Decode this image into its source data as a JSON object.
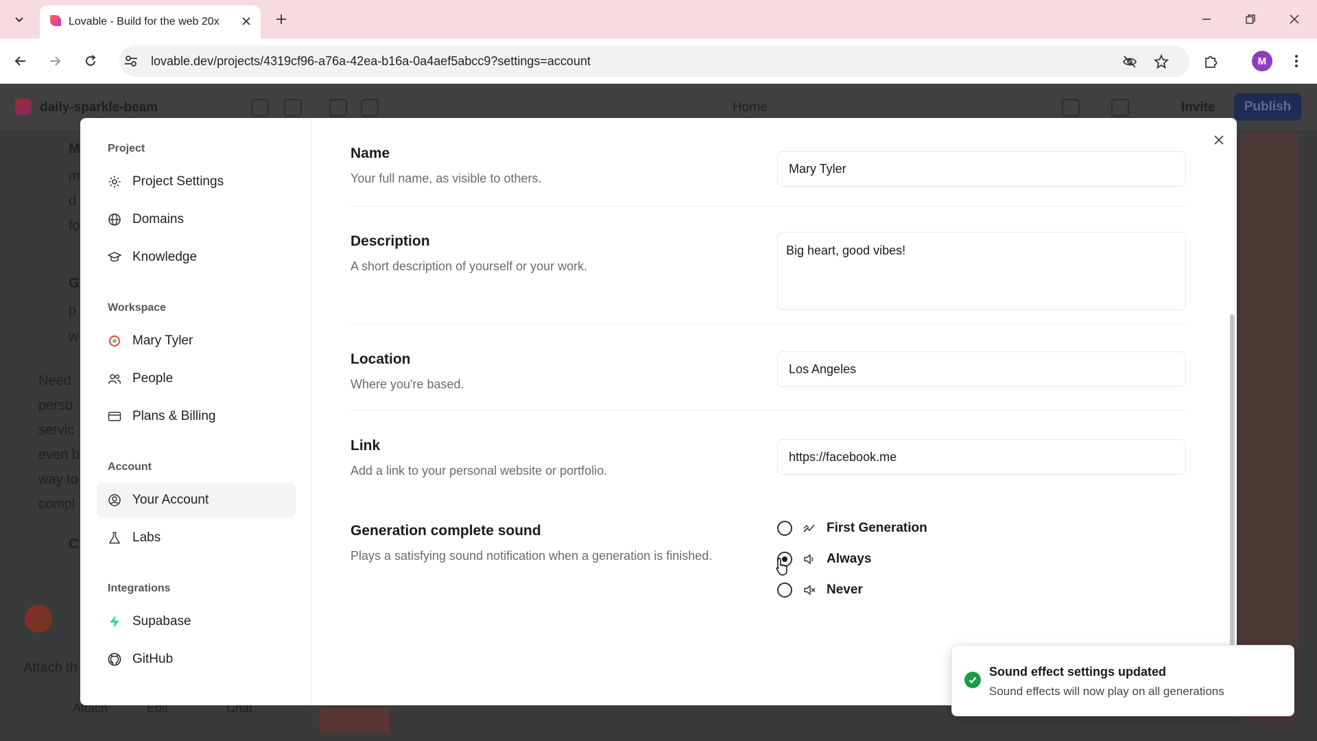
{
  "browser": {
    "tab_title": "Lovable - Build for the web 20x",
    "url": "lovable.dev/projects/4319cf96-a76a-42ea-b16a-0a4aef5abcc9?settings=account",
    "profile_initial": "M",
    "icons": {
      "tab_list": "chevron-down-icon",
      "favicon": "lovable-heart-icon",
      "tab_close": "close-icon",
      "new_tab": "plus-icon",
      "minimize": "minimize-icon",
      "restore": "restore-icon",
      "window_close": "close-icon",
      "back": "arrow-left-icon",
      "forward": "arrow-right-icon",
      "reload": "reload-icon",
      "site_settings": "tune-icon",
      "eye_off": "eye-off-icon",
      "bookmark": "star-icon",
      "extensions": "puzzle-icon",
      "menu": "kebab-icon"
    }
  },
  "background_app": {
    "project_name": "daily-sparkle-beam",
    "home_label": "Home",
    "invite_label": "Invite",
    "publish_label": "Publish",
    "chat_fragments": [
      "M",
      "m",
      "d",
      "fo",
      "G",
      "p",
      "w",
      "Need",
      "perso",
      "servic",
      "even b",
      "way to",
      "compl",
      "C"
    ],
    "composer_fragments": [
      "Attach th",
      "Attach",
      "Edit",
      "Chat"
    ]
  },
  "sidebar": {
    "sections": [
      {
        "title": "Project",
        "items": [
          {
            "label": "Project Settings",
            "icon": "gear-icon"
          },
          {
            "label": "Domains",
            "icon": "globe-icon"
          },
          {
            "label": "Knowledge",
            "icon": "graduation-cap-icon"
          }
        ]
      },
      {
        "title": "Workspace",
        "items": [
          {
            "label": "Mary Tyler",
            "icon": "workspace-avatar-icon"
          },
          {
            "label": "People",
            "icon": "users-icon"
          },
          {
            "label": "Plans & Billing",
            "icon": "credit-card-icon"
          }
        ]
      },
      {
        "title": "Account",
        "items": [
          {
            "label": "Your Account",
            "icon": "user-circle-icon",
            "active": true
          },
          {
            "label": "Labs",
            "icon": "flask-icon"
          }
        ]
      },
      {
        "title": "Integrations",
        "items": [
          {
            "label": "Supabase",
            "icon": "supabase-bolt-icon"
          },
          {
            "label": "GitHub",
            "icon": "github-icon"
          }
        ]
      }
    ]
  },
  "account": {
    "name": {
      "title": "Name",
      "description": "Your full name, as visible to others.",
      "value": "Mary Tyler"
    },
    "bio": {
      "title": "Description",
      "description": "A short description of yourself or your work.",
      "value": "Big heart, good vibes!"
    },
    "location": {
      "title": "Location",
      "description": "Where you're based.",
      "value": "Los Angeles"
    },
    "link": {
      "title": "Link",
      "description": "Add a link to your personal website or portfolio.",
      "value": "https://facebook.me"
    },
    "sound": {
      "title": "Generation complete sound",
      "description": "Plays a satisfying sound notification when a generation is finished.",
      "options": [
        {
          "label": "First Generation",
          "icon": "sparkle-trend-icon",
          "selected": false
        },
        {
          "label": "Always",
          "icon": "volume-icon",
          "selected": true
        },
        {
          "label": "Never",
          "icon": "volume-mute-icon",
          "selected": false
        }
      ]
    }
  },
  "toast": {
    "title": "Sound effect settings updated",
    "body": "Sound effects will now play on all generations",
    "icon": "check-circle-icon",
    "color": "#1a9c4a"
  },
  "colors": {
    "tabstrip": "#f8dbe0",
    "publish_bg": "#1e2b52",
    "supabase_green": "#3ecf8e"
  }
}
